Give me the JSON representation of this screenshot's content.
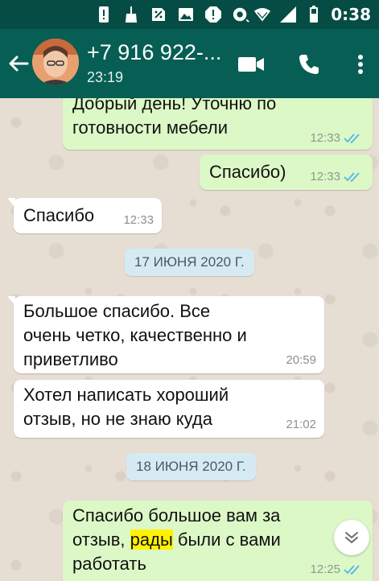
{
  "status_bar": {
    "time": "0:38",
    "icons": [
      "alert-icon",
      "broom-icon",
      "sim-icon",
      "image-icon",
      "alert-icon",
      "radio-icon",
      "wifi-icon",
      "signal-icon",
      "battery-icon"
    ]
  },
  "header": {
    "contact": "+7 916 922-...",
    "subtitle": "23:19",
    "actions": [
      "video-call-icon",
      "phone-icon",
      "more-icon"
    ]
  },
  "messages": [
    {
      "dir": "out",
      "text": "Добрый день! Уточню по\nготовности мебели",
      "time": "12:33",
      "read": true
    },
    {
      "dir": "out",
      "text": "Спасибо)",
      "time": "12:33",
      "read": true
    },
    {
      "dir": "in",
      "text": "Спасибо",
      "time": "12:33"
    },
    {
      "dir": "date",
      "text": "17 ИЮНЯ 2020 Г."
    },
    {
      "dir": "in",
      "text": "Большое спасибо. Все\nочень четко, качественно и\nприветливо",
      "time": "20:59"
    },
    {
      "dir": "in",
      "text": "Хотел написать хороший\nотзыв, но не знаю куда",
      "time": "21:02"
    },
    {
      "dir": "date",
      "text": "18 ИЮНЯ 2020 Г."
    },
    {
      "dir": "out",
      "text_line1": "Спасибо большое вам за",
      "text_line2_pre": "отзыв, ",
      "text_line2_hl": "рады",
      "text_line2_post": " были с вами",
      "text_line3": "работать",
      "time": "12:25",
      "read": true
    }
  ],
  "colors": {
    "status_bar": "#054d44",
    "app_bar": "#075e54",
    "outgoing_bubble": "#dcf8c6",
    "incoming_bubble": "#ffffff",
    "read_ticks": "#4fb6ec",
    "highlight": "#fff200"
  }
}
